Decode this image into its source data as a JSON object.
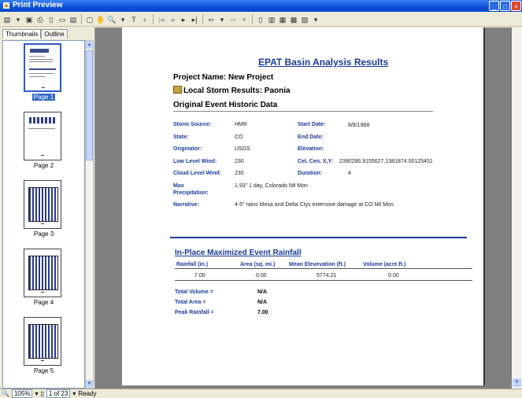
{
  "window": {
    "title": "Print Preview"
  },
  "tabs": [
    "Thumbnails",
    "Outline"
  ],
  "thumbnails": [
    {
      "label": "Page 1",
      "selected": true
    },
    {
      "label": "Page 2",
      "selected": false
    },
    {
      "label": "Page 3",
      "selected": false
    },
    {
      "label": "Page 4",
      "selected": false
    },
    {
      "label": "Page 5",
      "selected": false
    }
  ],
  "status": {
    "zoom": "105%",
    "page": "1 of 23",
    "text": "Ready"
  },
  "report": {
    "title": "EPAT Basin Analysis Results",
    "project": "Project Name: New Project",
    "local": "Local Storm Results: Paonia",
    "section1": "Original Event Historic Data",
    "fields": {
      "storm_source_label": "Storm Source:",
      "storm_source": "HMR",
      "state_label": "State:",
      "state": "CO",
      "originator_label": "Originator:",
      "originator": "USGS",
      "low_wind_label": "Low Level Wind:",
      "low_wind": "230",
      "cloud_wind_label": "Cloud Level Wind:",
      "cloud_wind": "230",
      "max_precip_label": "Max Precipitation:",
      "max_precip": "1.93\" 1 day, Colorado Ntl Mon",
      "narrative_label": "Narrative:",
      "narrative": "4-5\" rains Mesa and Delta Ctys extensive damage at CO Ntl Mon.",
      "start_date_label": "Start Date:",
      "start_date": "8/8/1968",
      "end_date_label": "End Date:",
      "end_date": "",
      "elevation_label": "Elevation:",
      "elevation": "",
      "cel_cen_label": "Cel. Cen. X,Y:",
      "cel_cen": "2390286.9155627,1381874.00125451",
      "duration_label": "Duration:",
      "duration": "4"
    },
    "section2": "In-Place Maximized Event Rainfall",
    "columns": [
      "Rainfall (in.)",
      "Area (sq. mi.)",
      "Mean Elevevation (ft.)",
      "Volume (acre.ft.)"
    ],
    "row": [
      "7.00",
      "0.00",
      "5774.21",
      "0.00"
    ],
    "totals": [
      {
        "label": "Total Volume =",
        "value": "N/A"
      },
      {
        "label": "Total Area =",
        "value": "N/A"
      },
      {
        "label": "Peak Rainfall =",
        "value": "7.00"
      }
    ]
  }
}
